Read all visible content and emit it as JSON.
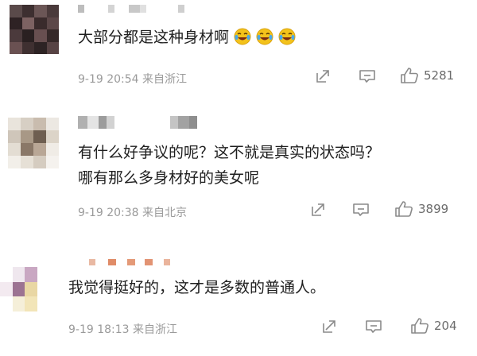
{
  "comments": [
    {
      "text_lines": [
        "大部分都是这种身材啊"
      ],
      "emoji": [
        "laugh-cry-emoji",
        "laugh-cry-emoji",
        "laugh-cry-emoji"
      ],
      "date": "9-19",
      "time": "20:54",
      "location": "来自浙江",
      "likes": "5281"
    },
    {
      "text_lines": [
        "有什么好争议的呢？这不就是真实的状态吗？",
        "哪有那么多身材好的美女呢"
      ],
      "emoji": [],
      "date": "9-19",
      "time": "20:38",
      "location": "来自北京",
      "likes": "3899"
    },
    {
      "text_lines": [
        "我觉得挺好的，这才是多数的普通人。"
      ],
      "emoji": [],
      "date": "9-19",
      "time": "18:13",
      "location": "来自浙江",
      "likes": "204"
    }
  ],
  "icons": {
    "share": "share-icon",
    "comment": "comment-icon",
    "like": "thumbs-up-icon"
  },
  "colors": {
    "text": "#1f1f1f",
    "meta": "#9a9a9a",
    "icon": "#8a8a8a",
    "emoji_face": "#f3c21b"
  }
}
